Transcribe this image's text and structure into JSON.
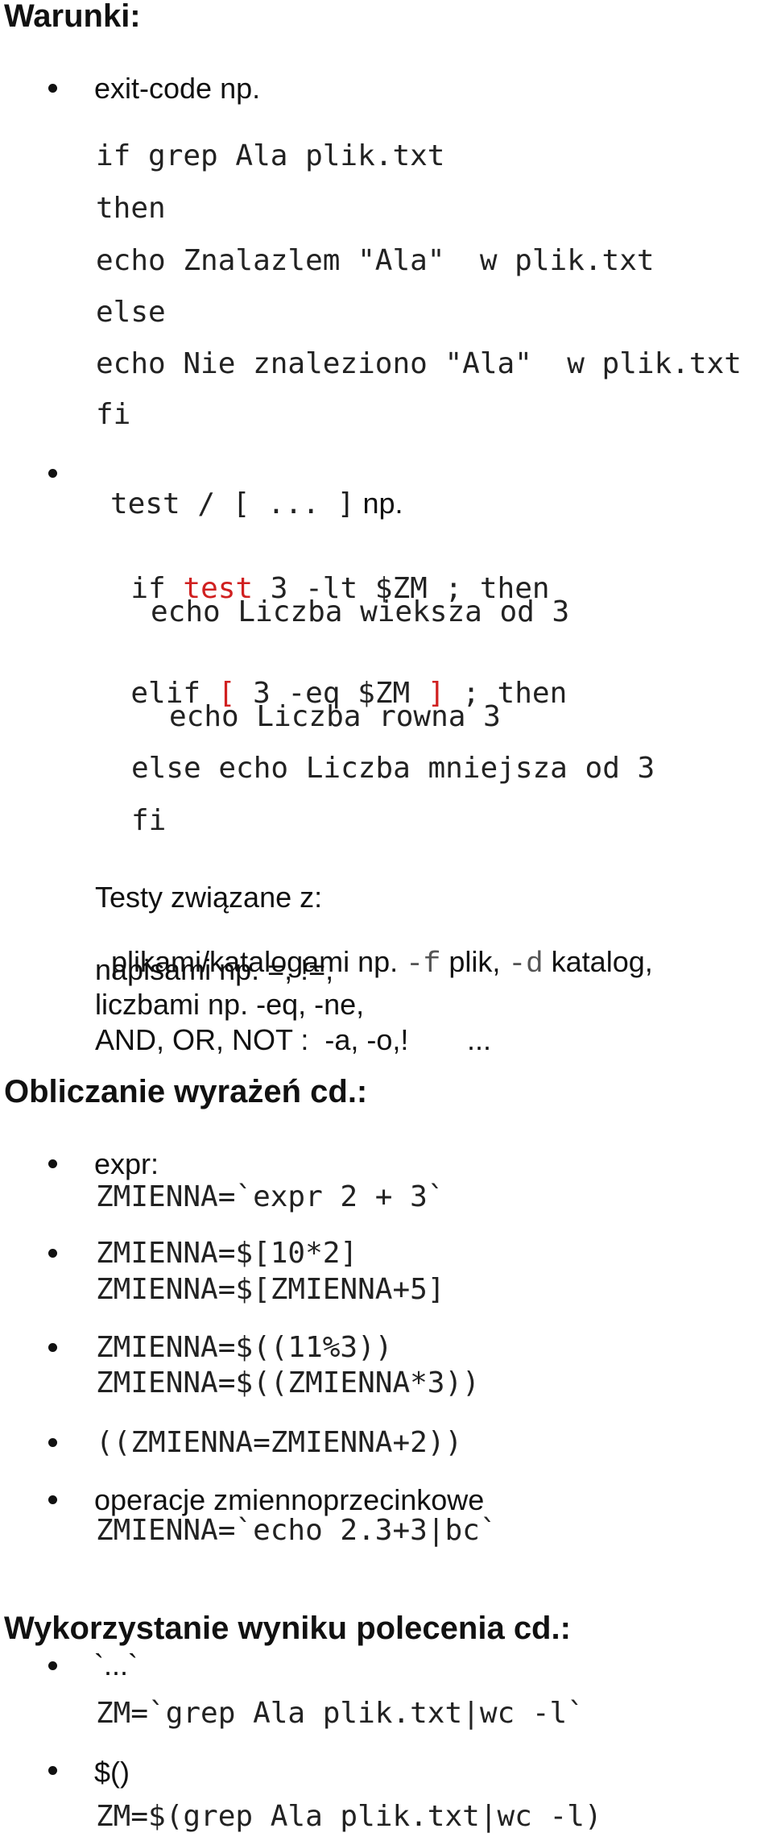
{
  "sections": {
    "conditions": {
      "title": "Warunki:",
      "exit_code": {
        "label": "exit-code np.",
        "code": [
          "if grep Ala plik.txt",
          "then",
          "echo Znalazlem \"Ala\"  w plik.txt",
          "else",
          "echo Nie znaleziono \"Ala\"  w plik.txt",
          "fi"
        ]
      },
      "test": {
        "label_code": "test / [ ... ]",
        "label_text": " np.",
        "code": {
          "line1_pre": "if ",
          "line1_kw": "test",
          "line1_post": " 3 -lt $ZM ; then",
          "line2": "echo Liczba wieksza od 3",
          "line3_pre": "elif ",
          "line3_open": "[",
          "line3_mid": " 3 -eq $ZM ",
          "line3_close": "]",
          "line3_post": " ; then",
          "line4": "echo Liczba rowna 3",
          "line5": "else echo Liczba mniejsza od 3",
          "line6": "fi"
        }
      },
      "tests_related": {
        "heading": "Testy związane z:",
        "files_pre": "plikami/katalogami np. ",
        "files_f": "-f",
        "files_mid": " plik, ",
        "files_d": "-d",
        "files_post": " katalog,",
        "strings": "napisami np. =, !=,",
        "numbers": "liczbami np. -eq, -ne,",
        "logic": "AND, OR, NOT :  -a, -o,!",
        "logic_ellipsis": "..."
      }
    },
    "expressions": {
      "title": "Obliczanie wyrażeń cd.:",
      "items": [
        {
          "label": "expr:",
          "code": [
            "ZMIENNA=`expr 2 + 3`"
          ]
        },
        {
          "label": "",
          "code": [
            "ZMIENNA=$[10*2]",
            "ZMIENNA=$[ZMIENNA+5]"
          ]
        },
        {
          "label": "",
          "code": [
            "ZMIENNA=$((11%3))",
            "ZMIENNA=$((ZMIENNA*3))"
          ]
        },
        {
          "label": "",
          "code": [
            "((ZMIENNA=ZMIENNA+2))"
          ]
        },
        {
          "label": "operacje zmiennoprzecinkowe",
          "code": [
            "ZMIENNA=`echo 2.3+3|bc`"
          ]
        }
      ]
    },
    "command_output": {
      "title": "Wykorzystanie wyniku polecenia cd.:",
      "items": [
        {
          "label": "`...`",
          "code": "ZM=`grep Ala plik.txt|wc -l`"
        },
        {
          "label": "$()",
          "code": "ZM=$(grep Ala plik.txt|wc -l)"
        }
      ]
    }
  },
  "colors": {
    "text": "#111111",
    "code": "#222222",
    "highlight_red": "#d02020",
    "option_gray": "#555555",
    "background": "#ffffff"
  }
}
